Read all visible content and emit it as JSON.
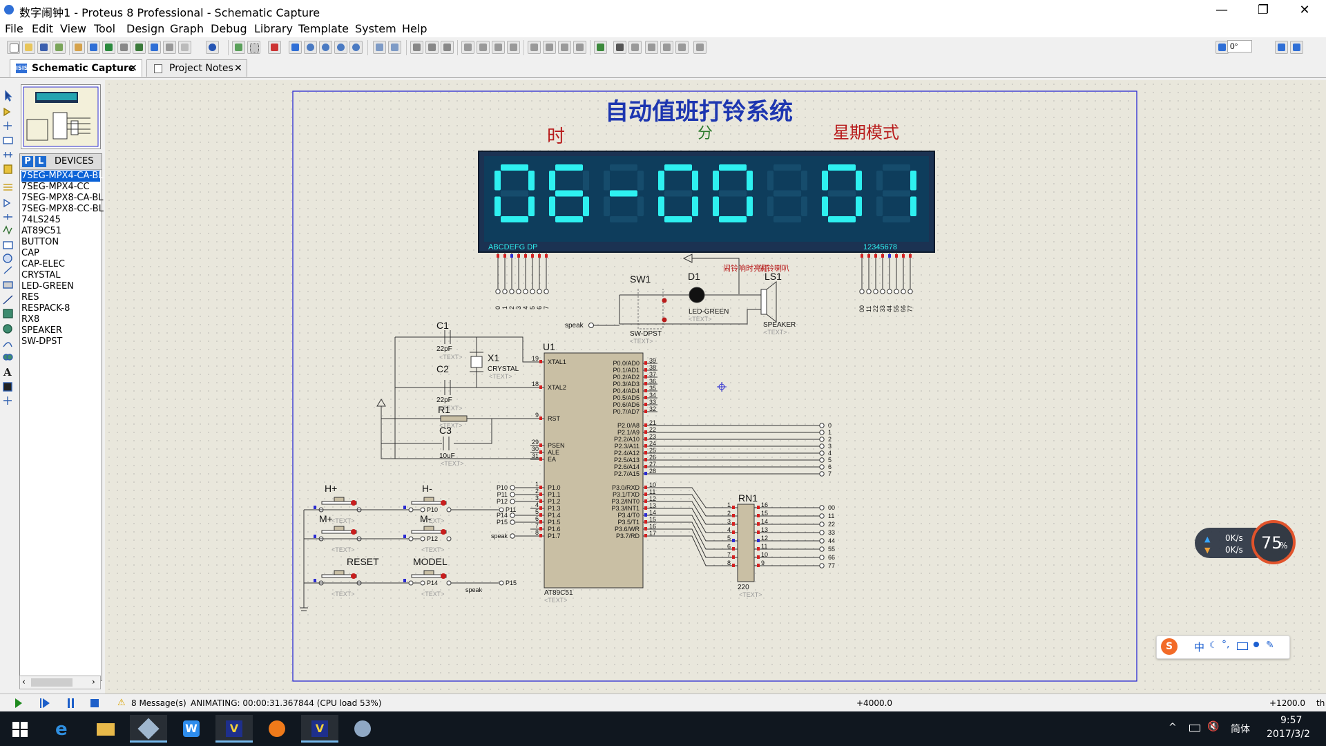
{
  "window": {
    "title": "数字闹钟1 - Proteus 8 Professional - Schematic Capture",
    "controls": [
      "—",
      "❐",
      "✕"
    ]
  },
  "menu": [
    "File",
    "Edit",
    "View",
    "Tool",
    "Design",
    "Graph",
    "Debug",
    "Library",
    "Template",
    "System",
    "Help"
  ],
  "toolbar": {
    "rotation_value": "0°"
  },
  "tabs": [
    {
      "label": "Schematic Capture",
      "icon": "schematic-icon",
      "active": true
    },
    {
      "label": "Project Notes",
      "icon": "notes-icon",
      "active": false
    }
  ],
  "device_panel": {
    "p_label": "P",
    "l_label": "L",
    "title": "DEVICES",
    "items": [
      "7SEG-MPX4-CA-BL",
      "7SEG-MPX4-CC",
      "7SEG-MPX8-CA-BL",
      "7SEG-MPX8-CC-BL",
      "74LS245",
      "AT89C51",
      "BUTTON",
      "CAP",
      "CAP-ELEC",
      "CRYSTAL",
      "LED-GREEN",
      "RES",
      "RESPACK-8",
      "RX8",
      "SPEAKER",
      "SW-DPST"
    ],
    "selected_index": 0
  },
  "schematic": {
    "title": "自动值班打铃系统",
    "labels": {
      "hour": "时",
      "minute": "分",
      "week_mode": "星期模式"
    },
    "display": {
      "digits": [
        "0",
        "6",
        "-",
        "0",
        "0",
        "",
        "0",
        "1"
      ],
      "seg_label": "ABCDEFG  DP",
      "digit_label": "12345678",
      "color": "#2ef0f0",
      "bg": "#0e3d5c"
    },
    "seg_pins": [
      "0",
      "1",
      "2",
      "3",
      "4",
      "5",
      "6",
      "7"
    ],
    "digit_pins": [
      "00",
      "11",
      "22",
      "33",
      "44",
      "55",
      "66",
      "77"
    ],
    "alarm_light_label": "闹铃响时亮灯",
    "alarm_speaker_label": "闹铃喇叭",
    "sw1": {
      "ref": "SW1",
      "part": "SW-DPST",
      "text": "<TEXT>"
    },
    "d1": {
      "ref": "D1",
      "part": "LED-GREEN",
      "text": "<TEXT>"
    },
    "ls1": {
      "ref": "LS1",
      "part": "SPEAKER",
      "text": "<TEXT>"
    },
    "speak_net": "speak",
    "c1": {
      "ref": "C1",
      "value": "22pF",
      "text": "<TEXT>"
    },
    "c2": {
      "ref": "C2",
      "value": "22pF",
      "text": "<TEXT>"
    },
    "x1": {
      "ref": "X1",
      "part": "CRYSTAL",
      "text": "<TEXT>"
    },
    "r1": {
      "ref": "R1",
      "text": "<TEXT>"
    },
    "c3": {
      "ref": "C3",
      "value": "10uF",
      "text": "<TEXT>"
    },
    "u1": {
      "ref": "U1",
      "part": "AT89C51",
      "text": "<TEXT>",
      "left_pins": [
        {
          "num": "19",
          "name": "XTAL1"
        },
        {
          "num": "18",
          "name": "XTAL2"
        },
        {
          "num": "9",
          "name": "RST"
        },
        {
          "num": "29",
          "name": "PSEN"
        },
        {
          "num": "30",
          "name": "ALE"
        },
        {
          "num": "31",
          "name": "EA"
        },
        {
          "num": "1",
          "name": "P1.0"
        },
        {
          "num": "2",
          "name": "P1.1"
        },
        {
          "num": "3",
          "name": "P1.2"
        },
        {
          "num": "4",
          "name": "P1.3"
        },
        {
          "num": "5",
          "name": "P1.4"
        },
        {
          "num": "6",
          "name": "P1.5"
        },
        {
          "num": "7",
          "name": "P1.6"
        },
        {
          "num": "8",
          "name": "P1.7"
        }
      ],
      "right_pins": [
        {
          "num": "39",
          "name": "P0.0/AD0"
        },
        {
          "num": "38",
          "name": "P0.1/AD1"
        },
        {
          "num": "37",
          "name": "P0.2/AD2"
        },
        {
          "num": "36",
          "name": "P0.3/AD3"
        },
        {
          "num": "35",
          "name": "P0.4/AD4"
        },
        {
          "num": "34",
          "name": "P0.5/AD5"
        },
        {
          "num": "33",
          "name": "P0.6/AD6"
        },
        {
          "num": "32",
          "name": "P0.7/AD7"
        },
        {
          "num": "21",
          "name": "P2.0/A8"
        },
        {
          "num": "22",
          "name": "P2.1/A9"
        },
        {
          "num": "23",
          "name": "P2.2/A10"
        },
        {
          "num": "24",
          "name": "P2.3/A11"
        },
        {
          "num": "25",
          "name": "P2.4/A12"
        },
        {
          "num": "26",
          "name": "P2.5/A13"
        },
        {
          "num": "27",
          "name": "P2.6/A14"
        },
        {
          "num": "28",
          "name": "P2.7/A15"
        },
        {
          "num": "10",
          "name": "P3.0/RXD"
        },
        {
          "num": "11",
          "name": "P3.1/TXD"
        },
        {
          "num": "12",
          "name": "P3.2/INT0"
        },
        {
          "num": "13",
          "name": "P3.3/INT1"
        },
        {
          "num": "14",
          "name": "P3.4/T0"
        },
        {
          "num": "15",
          "name": "P3.5/T1"
        },
        {
          "num": "16",
          "name": "P3.6/WR"
        },
        {
          "num": "17",
          "name": "P3.7/RD"
        }
      ],
      "p1_nets": [
        "P10",
        "P11",
        "P12",
        "",
        "P14",
        "P15",
        "",
        "speak"
      ]
    },
    "p2_nets": [
      "0",
      "1",
      "2",
      "3",
      "4",
      "5",
      "6",
      "7"
    ],
    "rn1": {
      "ref": "RN1",
      "value": "220",
      "text": "<TEXT>",
      "left_pins": [
        "1",
        "2",
        "3",
        "4",
        "5",
        "6",
        "7",
        "8"
      ],
      "right_pins": [
        "16",
        "15",
        "14",
        "13",
        "12",
        "11",
        "10",
        "9"
      ],
      "nets": [
        "00",
        "11",
        "22",
        "33",
        "44",
        "55",
        "66",
        "77"
      ]
    },
    "buttons": [
      {
        "ref": "H+",
        "net": "P10"
      },
      {
        "ref": "H-",
        "net": "P11"
      },
      {
        "ref": "M+",
        "net": "P12"
      },
      {
        "ref": "M-",
        "net": ""
      },
      {
        "ref": "RESET",
        "net": "P14"
      },
      {
        "ref": "MODEL",
        "net": "P15"
      }
    ],
    "button_text": "<TEXT>"
  },
  "status": {
    "messages": "8 Message(s)",
    "animating": "ANIMATING: 00:00:31.367844 (CPU load 53%)",
    "coord_x": "+4000.0",
    "coord_y": "+1200.0",
    "unit": "th"
  },
  "net_widget": {
    "up": "0K/s",
    "down": "0K/s",
    "percent": "75",
    "percent_sign": "%"
  },
  "ime_widget": {
    "label": "中"
  },
  "taskbar": {
    "tray_ime": "简体",
    "time": "9:57",
    "date": "2017/3/2"
  }
}
